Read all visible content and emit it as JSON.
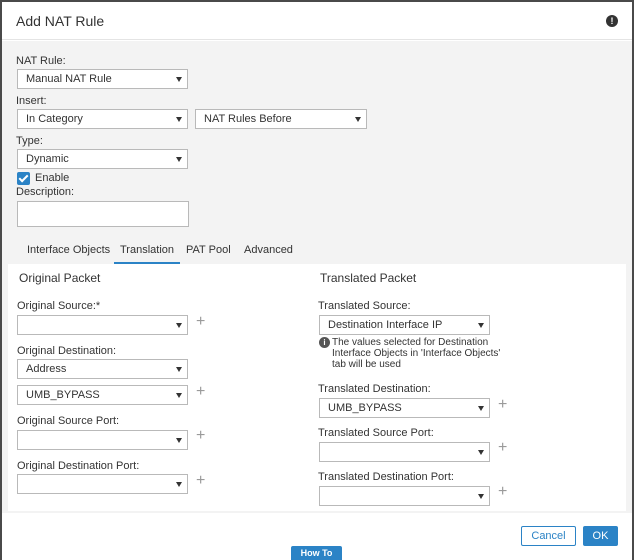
{
  "dialog": {
    "title": "Add NAT Rule",
    "help_icon_glyph": "!"
  },
  "form": {
    "nat_rule_label": "NAT Rule:",
    "nat_rule_value": "Manual NAT Rule",
    "insert_label": "Insert:",
    "insert_value": "In Category",
    "insert_position_value": "NAT Rules Before",
    "type_label": "Type:",
    "type_value": "Dynamic",
    "enable_label": "Enable",
    "enable_checked": true,
    "description_label": "Description:",
    "description_value": ""
  },
  "tabs": [
    "Interface Objects",
    "Translation",
    "PAT Pool",
    "Advanced"
  ],
  "active_tab": "Translation",
  "original": {
    "title": "Original Packet",
    "source_label": "Original Source:*",
    "source_value": "",
    "destination_label": "Original Destination:",
    "destination_type_value": "Address",
    "destination_value": "UMB_BYPASS",
    "source_port_label": "Original Source Port:",
    "source_port_value": "",
    "destination_port_label": "Original Destination Port:",
    "destination_port_value": ""
  },
  "translated": {
    "title": "Translated Packet",
    "source_label": "Translated Source:",
    "source_value": "Destination Interface IP",
    "info_glyph": "i",
    "info_text": "The values selected for Destination Interface Objects in 'Interface Objects' tab will be used",
    "destination_label": "Translated Destination:",
    "destination_value": "UMB_BYPASS",
    "source_port_label": "Translated Source Port:",
    "source_port_value": "",
    "destination_port_label": "Translated Destination Port:",
    "destination_port_value": ""
  },
  "footer": {
    "cancel_label": "Cancel",
    "ok_label": "OK",
    "howto_label": "How To"
  },
  "icons": {
    "plus": "+"
  },
  "colors": {
    "accent": "#2b83c6",
    "body_bg": "#f3f3f3"
  }
}
